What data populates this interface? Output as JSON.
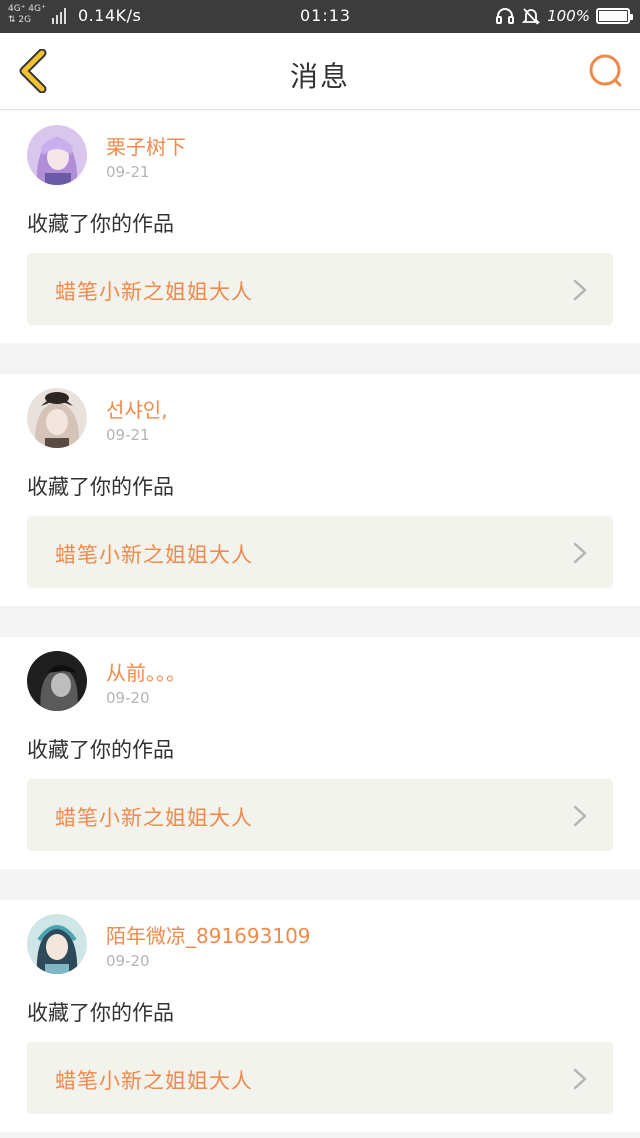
{
  "status_bar": {
    "network_top": "4G⁺ 4G⁺",
    "network_bottom": "⇅ 2G",
    "speed": "0.14K/s",
    "time": "01:13",
    "battery_pct": "100%"
  },
  "header": {
    "title": "消息",
    "back_icon": "chevron-left-icon",
    "search_icon": "search-icon"
  },
  "colors": {
    "accent": "#f08a4b",
    "back_arrow": "#f2c230",
    "card_bg": "#f3f3ee"
  },
  "messages": [
    {
      "user": "栗子树下",
      "date": "09-21",
      "action": "收藏了你的作品",
      "work_title": "蜡笔小新之姐姐大人"
    },
    {
      "user": "선샤인,",
      "date": "09-21",
      "action": "收藏了你的作品",
      "work_title": "蜡笔小新之姐姐大人"
    },
    {
      "user": "从前。。。",
      "date": "09-20",
      "action": "收藏了你的作品",
      "work_title": "蜡笔小新之姐姐大人"
    },
    {
      "user": "陌年微凉_891693109",
      "date": "09-20",
      "action": "收藏了你的作品",
      "work_title": "蜡笔小新之姐姐大人"
    }
  ]
}
